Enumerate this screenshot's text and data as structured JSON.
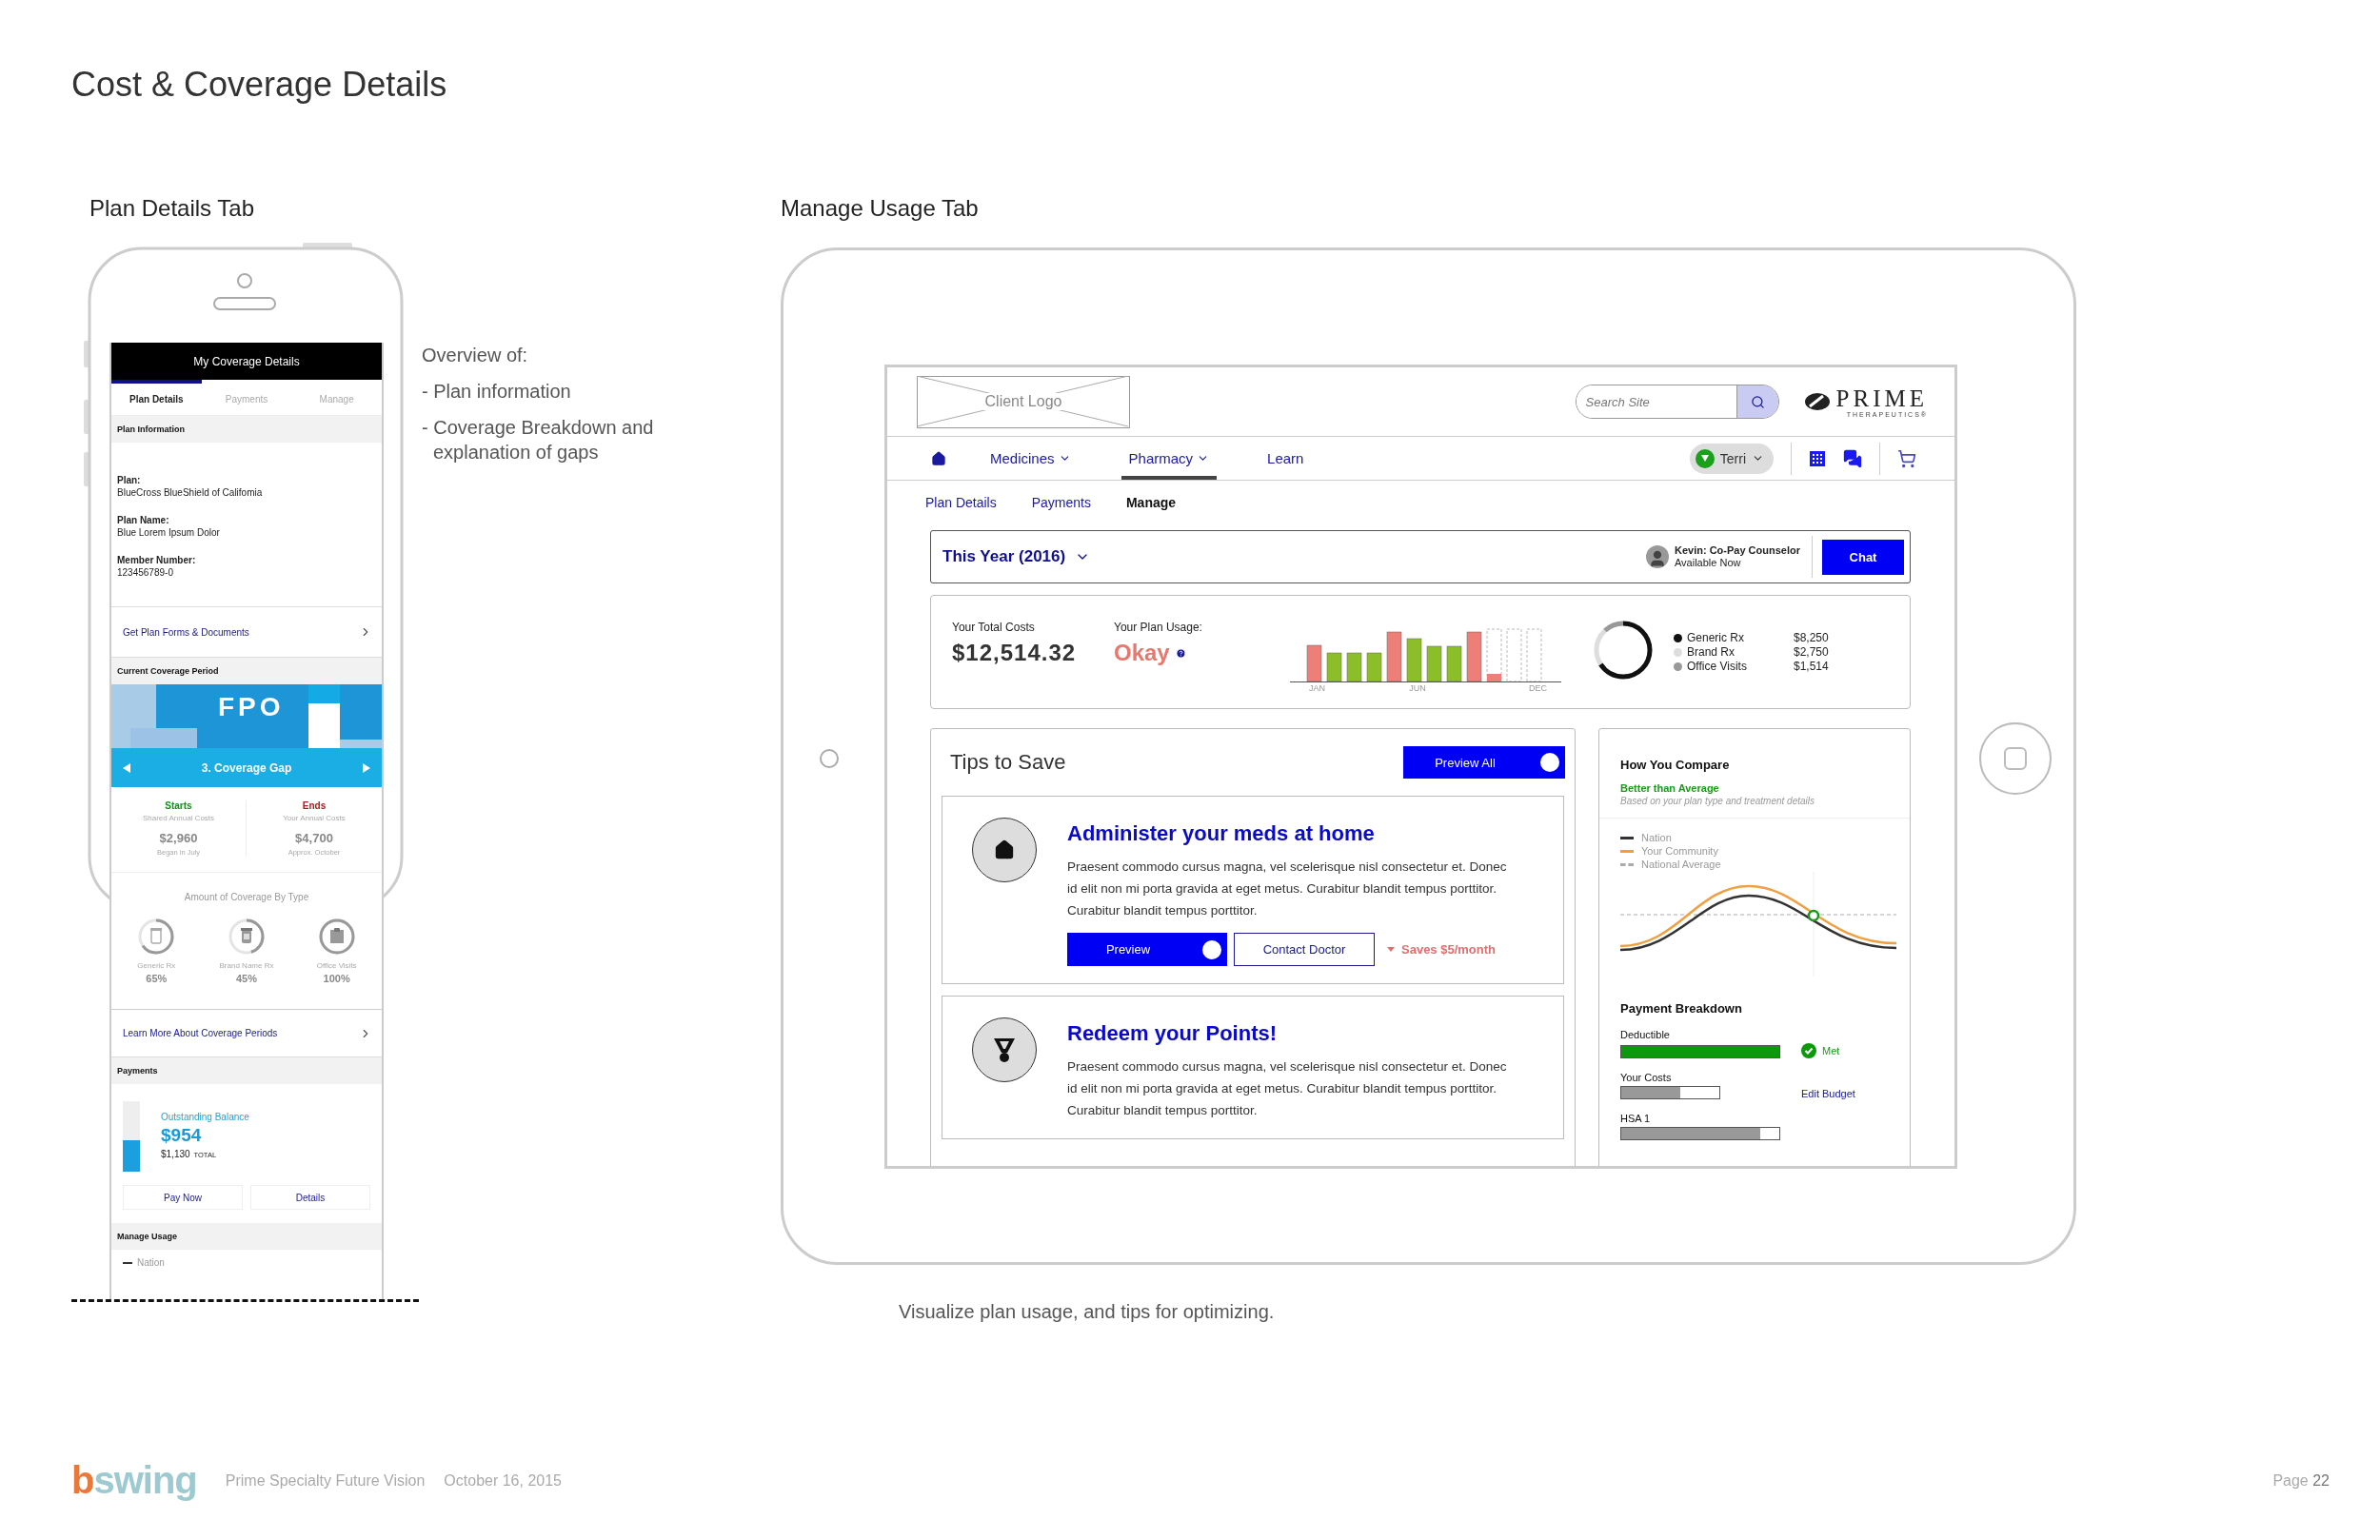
{
  "title": "Cost & Coverage Details",
  "plan_details_tab": {
    "heading": "Plan Details Tab",
    "phone": {
      "header": "My Coverage Details",
      "tabs": [
        {
          "label": "Plan Details",
          "selected": true
        },
        {
          "label": "Payments",
          "selected": false
        },
        {
          "label": "Manage",
          "selected": false
        }
      ],
      "plan_information": {
        "heading": "Plan Information",
        "fields": [
          {
            "label": "Plan:",
            "value": "BlueCross BlueShield of Califomia"
          },
          {
            "label": "Plan Name:",
            "value": "Blue Lorem Ipsum Dolor"
          },
          {
            "label": "Member Number:",
            "value": "123456789-0"
          }
        ]
      },
      "forms_link": "Get Plan Forms & Documents",
      "coverage_period": {
        "heading": "Current Coverage Period",
        "image_label": "FPO",
        "period": "3. Coverage Gap",
        "columns": [
          {
            "kind": "start",
            "label": "Starts",
            "caption": "Shared Annual Costs",
            "amount": "$2,960",
            "note": "Began in July"
          },
          {
            "kind": "end",
            "label": "Ends",
            "caption": "Your Annual Costs",
            "amount": "$4,700",
            "note": "Approx. October"
          }
        ],
        "by_type_heading": "Amount of Coverage By Type",
        "types": [
          {
            "kind": "generic",
            "label": "Generic Rx",
            "percent": "65%",
            "level": 0.65
          },
          {
            "kind": "brand",
            "label": "Brand Name Rx",
            "percent": "45%",
            "level": 0.45
          },
          {
            "kind": "office",
            "label": "Office Visits",
            "percent": "100%",
            "level": 1
          }
        ]
      },
      "learn_link": "Learn More About Coverage Periods",
      "payments": {
        "heading": "Payments",
        "balance_label": "Outstanding Balance",
        "balance": "$954",
        "total": "$1,130",
        "total_label": "TOTAL",
        "level": 0.45,
        "buttons": [
          "Pay Now",
          "Details"
        ]
      },
      "manage_usage": {
        "heading": "Manage Usage",
        "legend": [
          "Nation"
        ]
      }
    },
    "overview": {
      "heading": "Overview of:",
      "items": [
        "- Plan information",
        "- Coverage Breakdown and explanation of gaps"
      ]
    }
  },
  "manage_usage_tab": {
    "heading": "Manage Usage Tab",
    "tablet": {
      "header": {
        "logo_placeholder": "Client Logo",
        "search": {
          "placeholder": "Search Site"
        },
        "brand": {
          "name": "PRIME",
          "tagline": "THERAPEUTICS®"
        }
      },
      "nav": {
        "items": [
          {
            "kind": "home",
            "selected": false
          },
          {
            "kind": "menu",
            "label": "Medicines",
            "selected": false
          },
          {
            "kind": "menu",
            "label": "Pharmacy",
            "selected": true
          },
          {
            "kind": "link",
            "label": "Learn",
            "selected": false
          }
        ],
        "user": "Terri"
      },
      "subtabs": [
        {
          "label": "Plan Details",
          "selected": false
        },
        {
          "label": "Payments",
          "selected": false
        },
        {
          "label": "Manage",
          "selected": true
        }
      ],
      "year_bar": {
        "period": "This Year (2016)",
        "counselor": {
          "name": "Kevin: Co-Pay Counselor",
          "status": "Available Now"
        },
        "chat_button": "Chat"
      },
      "summary": {
        "total_label": "Your Total Costs",
        "total": "$12,514.32",
        "usage_label": "Your Plan Usage:",
        "usage": "Okay",
        "chart_labels": [
          "JAN",
          "JUN",
          "DEC"
        ],
        "breakdown": [
          {
            "label": "Generic Rx",
            "amount": "$8,250",
            "color": "#111111"
          },
          {
            "label": "Brand Rx",
            "amount": "$2,750",
            "color": "#dddddd"
          },
          {
            "label": "Office Visits",
            "amount": "$1,514",
            "color": "#999999"
          }
        ]
      },
      "tips": {
        "heading": "Tips to Save",
        "preview_all": {
          "label": "Preview All",
          "on": true
        },
        "items": [
          {
            "kind": "home",
            "title": "Administer your meds at home",
            "body": "Praesent commodo cursus magna, vel scelerisque nisl consectetur et. Donec id elit non mi porta gravida at eget metus. Curabitur blandit tempus porttitor. Curabitur blandit tempus porttitor.",
            "preview": {
              "label": "Preview",
              "on": true
            },
            "contact": "Contact Doctor",
            "savings": "Saves $5/month"
          },
          {
            "kind": "medal",
            "title": "Redeem your Points!",
            "body": "Praesent commodo cursus magna, vel scelerisque nisl consectetur et. Donec id elit non mi porta gravida at eget metus. Curabitur blandit tempus porttitor. Curabitur blandit tempus porttitor."
          }
        ]
      },
      "compare": {
        "heading": "How You Compare",
        "verdict": "Better than Average",
        "note": "Based on your plan type and treatment details",
        "legend": [
          {
            "kind": "solid",
            "label": "Nation",
            "color": "#333333"
          },
          {
            "kind": "solid",
            "label": "Your Community",
            "color": "#f0a040"
          },
          {
            "kind": "dashed",
            "label": "National Average",
            "color": "#aaaaaa"
          }
        ],
        "payment_heading": "Payment Breakdown",
        "bars": [
          {
            "kind": "met",
            "label": "Deductible",
            "level": 1,
            "status": "Met"
          },
          {
            "kind": "link",
            "label": "Your Costs",
            "level": 0.6,
            "action": "Edit Budget"
          },
          {
            "kind": "plain",
            "label": "HSA 1",
            "level": 0.88
          }
        ]
      }
    },
    "caption": "Visualize plan usage, and tips for optimizing."
  },
  "footer": {
    "brand": "bswing",
    "project": "Prime Specialty Future Vision",
    "date": "October 16, 2015",
    "page": "Page **22**"
  }
}
